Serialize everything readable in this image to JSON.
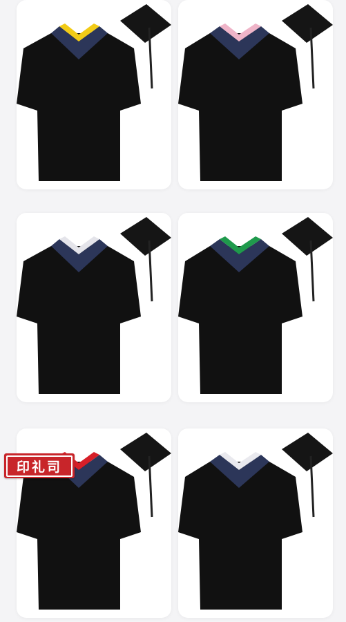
{
  "products": [
    {
      "name": "gown-yellow-trim",
      "trim_color": "#f2cb16",
      "cap_size": "large"
    },
    {
      "name": "gown-pink-trim",
      "trim_color": "#efb4c8",
      "cap_size": "large"
    },
    {
      "name": "gown-white-trim",
      "trim_color": "#e4e4ea",
      "cap_size": "large"
    },
    {
      "name": "gown-green-trim",
      "trim_color": "#1f9a4c",
      "cap_size": "large"
    },
    {
      "name": "gown-red-trim",
      "trim_color": "#d61f28",
      "cap_size": "large"
    },
    {
      "name": "gown-silver-trim",
      "trim_color": "#e9e9ee",
      "cap_size": "large"
    }
  ],
  "brand_seal": {
    "text": "印礼司",
    "color": "#c8252a"
  },
  "colors": {
    "gown": "#111111",
    "hood_pattern": "#2c3659",
    "page_bg": "#f4f4f6"
  }
}
